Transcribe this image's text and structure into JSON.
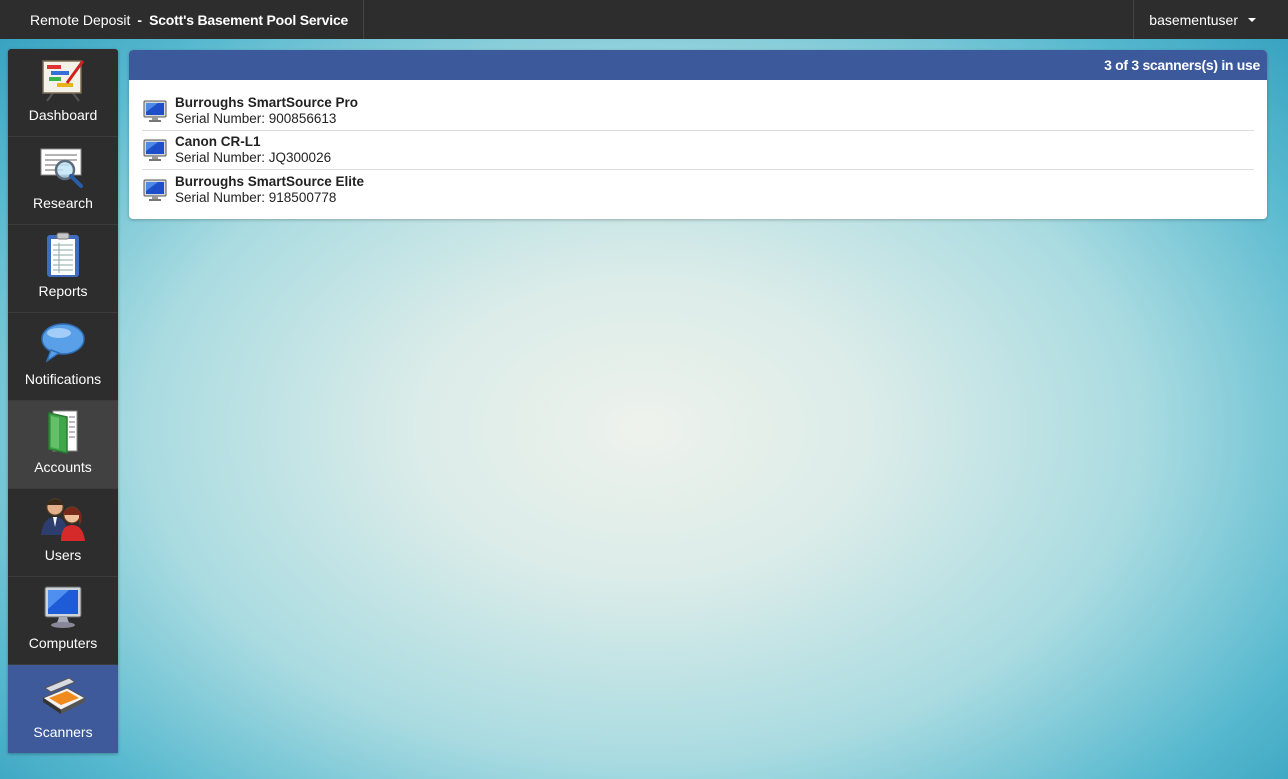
{
  "header": {
    "app_name": "Remote Deposit",
    "separator": "-",
    "company": "Scott's Basement Pool Service",
    "user": "basementuser"
  },
  "sidebar": {
    "items": [
      {
        "label": "Dashboard",
        "icon": "dashboard-chart-icon"
      },
      {
        "label": "Research",
        "icon": "magnifier-document-icon"
      },
      {
        "label": "Reports",
        "icon": "clipboard-report-icon"
      },
      {
        "label": "Notifications",
        "icon": "speech-bubble-icon"
      },
      {
        "label": "Accounts",
        "icon": "green-folder-icon"
      },
      {
        "label": "Users",
        "icon": "users-icon"
      },
      {
        "label": "Computers",
        "icon": "monitor-icon"
      },
      {
        "label": "Scanners",
        "icon": "scanner-icon"
      }
    ],
    "active": "Scanners"
  },
  "panel": {
    "status": "3 of 3 scanners(s) in use",
    "scanners": [
      {
        "name": "Burroughs SmartSource Pro",
        "serial": "Serial Number: 900856613"
      },
      {
        "name": "Canon CR-L1",
        "serial": "Serial Number: JQ300026"
      },
      {
        "name": "Burroughs SmartSource Elite",
        "serial": "Serial Number: 918500778"
      }
    ]
  },
  "colors": {
    "topbar": "#2d2d2d",
    "sidebar": "#2d2d2d",
    "active_nav": "#3e5a9b",
    "panel_header": "#3c5a9b"
  }
}
